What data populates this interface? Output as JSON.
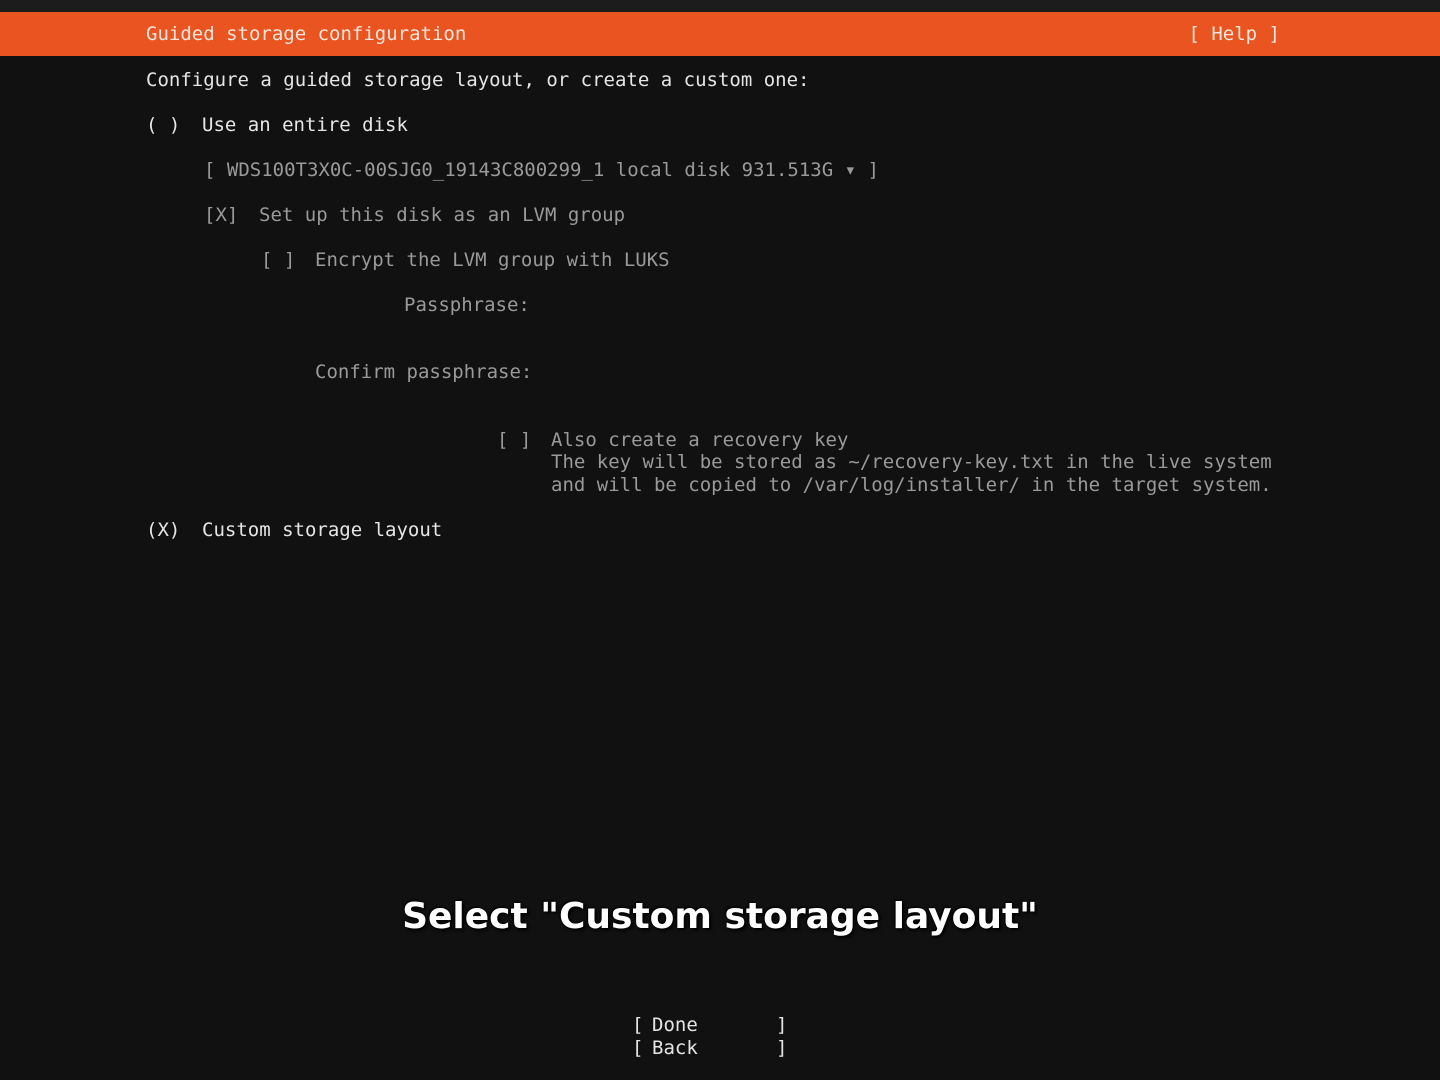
{
  "header": {
    "title": "Guided storage configuration",
    "help": "[ Help ]"
  },
  "intro": "Configure a guided storage layout, or create a custom one:",
  "options": {
    "entire_disk": {
      "radio": "( )",
      "label": "Use an entire disk"
    },
    "disk_select": {
      "text": "[ WDS100T3X0C-00SJG0_19143C800299_1 local disk 931.513G ▾ ]"
    },
    "lvm": {
      "checkbox": "[X]",
      "label": "Set up this disk as an LVM group"
    },
    "luks": {
      "checkbox": "[ ]",
      "label": "Encrypt the LVM group with LUKS"
    },
    "passphrase_label": "Passphrase:",
    "passphrase_value": "",
    "confirm_label": "Confirm passphrase:",
    "confirm_value": "",
    "recovery": {
      "checkbox": "[ ]",
      "label": "Also create a recovery key",
      "help_line1": "The key will be stored as ~/recovery-key.txt in the live system",
      "help_line2": "and will be copied to /var/log/installer/ in the target system."
    },
    "custom": {
      "radio": "(X)",
      "label": "Custom storage layout"
    }
  },
  "caption": "Select \"Custom storage layout\"",
  "buttons": {
    "done": "Done",
    "back": "Back",
    "left_bracket": "[",
    "right_bracket": "]"
  },
  "colors": {
    "accent": "#e95420",
    "background": "#111111",
    "text": "#e6e6e6",
    "disabled_text": "#9a9a9a"
  }
}
